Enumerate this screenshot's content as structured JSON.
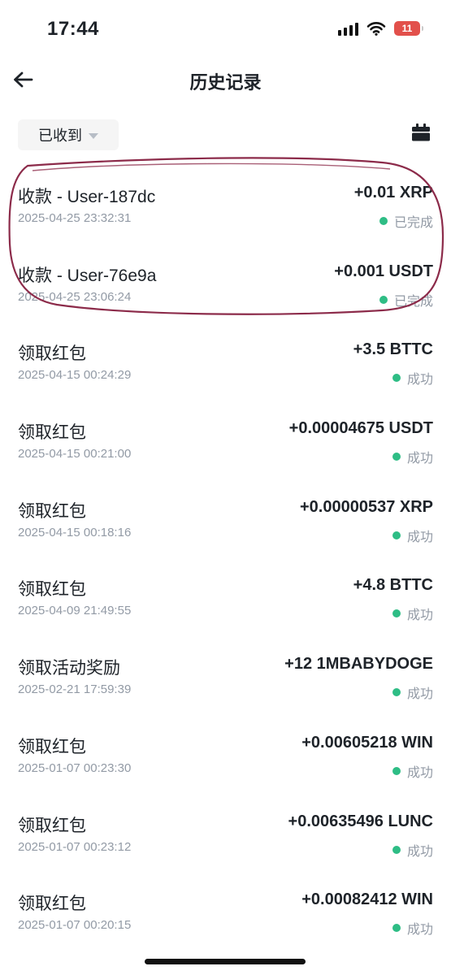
{
  "status_bar": {
    "time": "17:44",
    "battery": "11"
  },
  "header": {
    "title": "历史记录"
  },
  "filter": {
    "label": "已收到"
  },
  "colors": {
    "success": "#2ebd85",
    "annotation": "#8c2b4a",
    "battery": "#e2504b"
  },
  "items": [
    {
      "title": "收款 - User-187dc",
      "time": "2025-04-25 23:32:31",
      "amount": "+0.01 XRP",
      "status": "已完成"
    },
    {
      "title": "收款 - User-76e9a",
      "time": "2025-04-25 23:06:24",
      "amount": "+0.001 USDT",
      "status": "已完成"
    },
    {
      "title": "领取红包",
      "time": "2025-04-15 00:24:29",
      "amount": "+3.5 BTTC",
      "status": "成功"
    },
    {
      "title": "领取红包",
      "time": "2025-04-15 00:21:00",
      "amount": "+0.00004675 USDT",
      "status": "成功"
    },
    {
      "title": "领取红包",
      "time": "2025-04-15 00:18:16",
      "amount": "+0.00000537 XRP",
      "status": "成功"
    },
    {
      "title": "领取红包",
      "time": "2025-04-09 21:49:55",
      "amount": "+4.8 BTTC",
      "status": "成功"
    },
    {
      "title": "领取活动奖励",
      "time": "2025-02-21 17:59:39",
      "amount": "+12 1MBABYDOGE",
      "status": "成功"
    },
    {
      "title": "领取红包",
      "time": "2025-01-07 00:23:30",
      "amount": "+0.00605218 WIN",
      "status": "成功"
    },
    {
      "title": "领取红包",
      "time": "2025-01-07 00:23:12",
      "amount": "+0.00635496 LUNC",
      "status": "成功"
    },
    {
      "title": "领取红包",
      "time": "2025-01-07 00:20:15",
      "amount": "+0.00082412 WIN",
      "status": "成功"
    }
  ]
}
